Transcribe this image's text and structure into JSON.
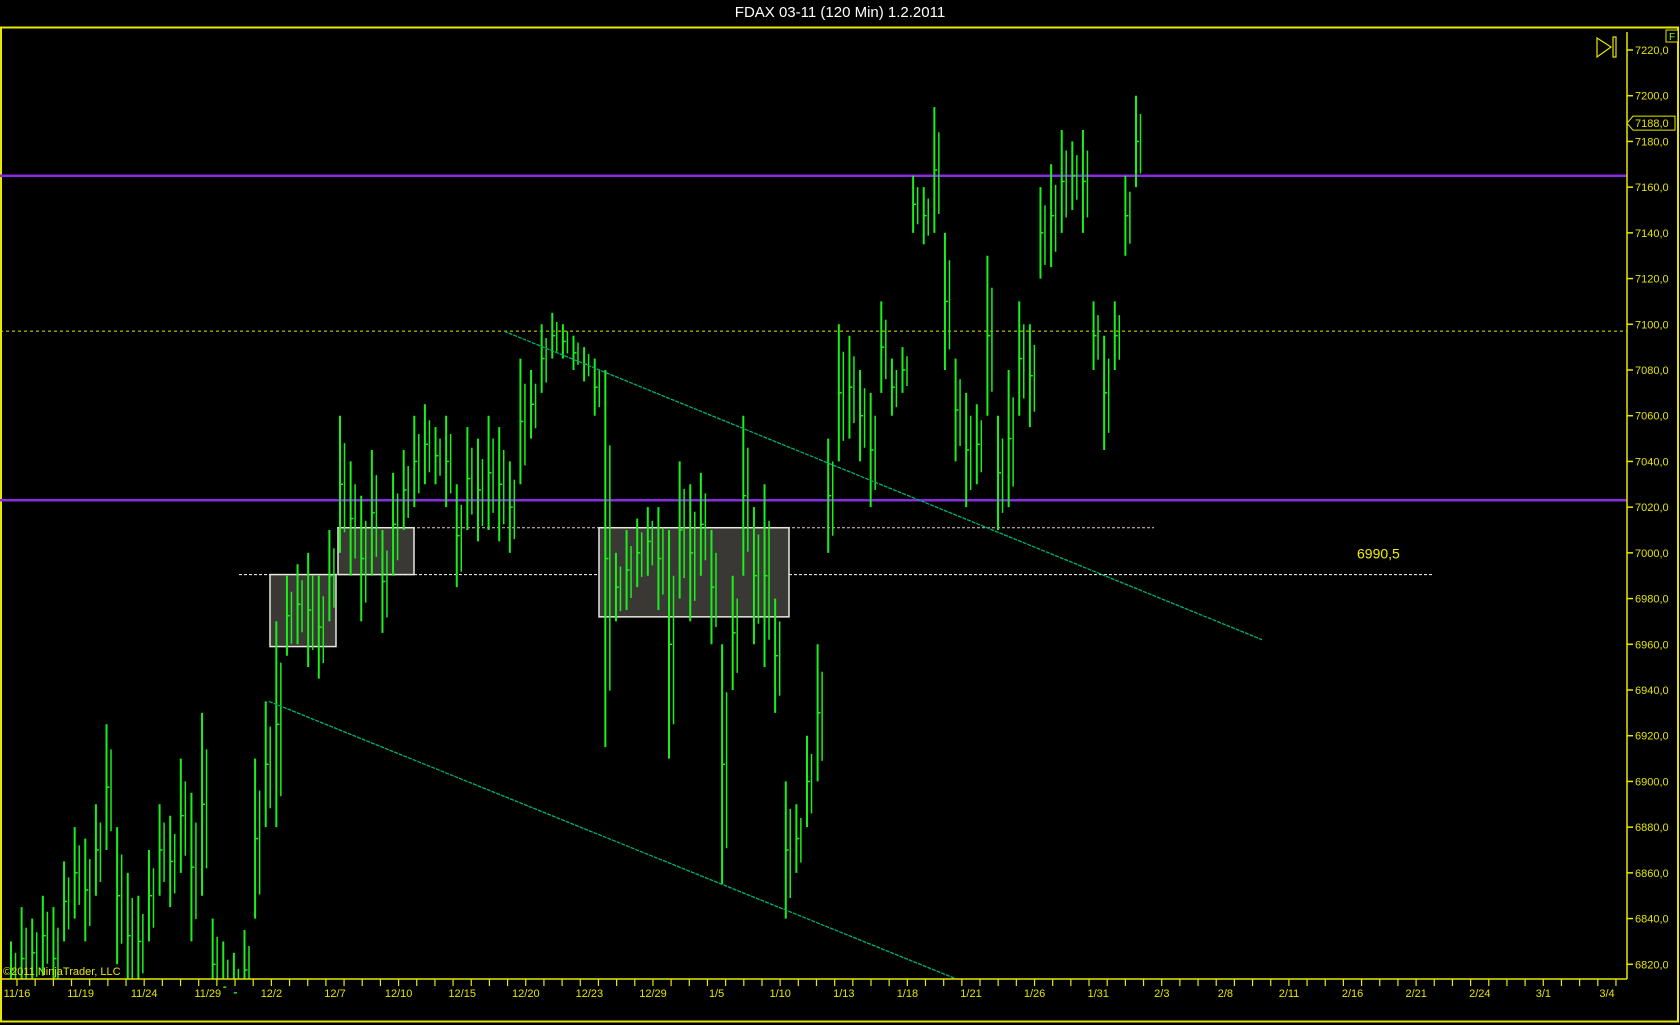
{
  "window": {
    "title": "FDAX 03-11 (120 Min)  1.2.2011"
  },
  "copyright": "©2011 NinjaTrader, LLC",
  "scale_button": "F",
  "colors": {
    "bars": "#19f019",
    "axis": "#e8e800",
    "level": "#8a2be2",
    "trend": "#00b070",
    "box_fill": "#3a3834",
    "box_stroke": "#e8e8e0"
  },
  "chart_data": {
    "type": "bar",
    "title": "FDAX 03-11 (120 Min)  1.2.2011",
    "ylim": [
      6810,
      7228
    ],
    "yticks": [
      "7220,0",
      "7200,0",
      "7180,0",
      "7160,0",
      "7140,0",
      "7120,0",
      "7100,0",
      "7080,0",
      "7060,0",
      "7040,0",
      "7020,0",
      "7000,0",
      "6980,0",
      "6960,0",
      "6940,0",
      "6920,0",
      "6900,0",
      "6880,0",
      "6860,0",
      "6840,0",
      "6820,0"
    ],
    "ytick_values": [
      7220,
      7200,
      7180,
      7160,
      7140,
      7120,
      7100,
      7080,
      7060,
      7040,
      7020,
      7000,
      6980,
      6960,
      6940,
      6920,
      6900,
      6880,
      6860,
      6840,
      6820
    ],
    "xticks": [
      "11/16",
      "11/19",
      "11/24",
      "11/29",
      "12/2",
      "12/7",
      "12/10",
      "12/15",
      "12/20",
      "12/23",
      "12/29",
      "1/5",
      "1/10",
      "1/13",
      "1/18",
      "1/21",
      "1/26",
      "1/31",
      "2/3",
      "2/8",
      "2/11",
      "2/16",
      "2/21",
      "2/24",
      "3/1",
      "3/4"
    ],
    "last_price": {
      "label": "7188,0",
      "value": 7188
    },
    "bars_high_low": [
      [
        6830,
        6805
      ],
      [
        6845,
        6800
      ],
      [
        6840,
        6810
      ],
      [
        6850,
        6815
      ],
      [
        6845,
        6800
      ],
      [
        6865,
        6830
      ],
      [
        6880,
        6840
      ],
      [
        6875,
        6830
      ],
      [
        6890,
        6850
      ],
      [
        6925,
        6870
      ],
      [
        6880,
        6820
      ],
      [
        6860,
        6805
      ],
      [
        6850,
        6810
      ],
      [
        6870,
        6830
      ],
      [
        6890,
        6850
      ],
      [
        6885,
        6845
      ],
      [
        6910,
        6860
      ],
      [
        6895,
        6830
      ],
      [
        6930,
        6850
      ],
      [
        6840,
        6800
      ],
      [
        6830,
        6790
      ],
      [
        6825,
        6790
      ],
      [
        6835,
        6800
      ],
      [
        6910,
        6840
      ],
      [
        6935,
        6880
      ],
      [
        6970,
        6880
      ],
      [
        6990,
        6955
      ],
      [
        6995,
        6960
      ],
      [
        7000,
        6950
      ],
      [
        6990,
        6945
      ],
      [
        7010,
        6970
      ],
      [
        7060,
        7000
      ],
      [
        7040,
        6990
      ],
      [
        7025,
        6970
      ],
      [
        7045,
        6990
      ],
      [
        7010,
        6965
      ],
      [
        7035,
        6990
      ],
      [
        7045,
        7010
      ],
      [
        7060,
        7020
      ],
      [
        7065,
        7030
      ],
      [
        7055,
        7030
      ],
      [
        7060,
        7020
      ],
      [
        7030,
        6985
      ],
      [
        7055,
        7010
      ],
      [
        7050,
        7005
      ],
      [
        7060,
        7010
      ],
      [
        7055,
        7005
      ],
      [
        7040,
        7000
      ],
      [
        7085,
        7030
      ],
      [
        7080,
        7050
      ],
      [
        7100,
        7070
      ],
      [
        7105,
        7085
      ],
      [
        7100,
        7085
      ],
      [
        7095,
        7080
      ],
      [
        7090,
        7075
      ],
      [
        7085,
        7060
      ],
      [
        7080,
        6915
      ],
      [
        7000,
        6970
      ],
      [
        7010,
        6975
      ],
      [
        7015,
        6985
      ],
      [
        7020,
        6990
      ],
      [
        7020,
        6975
      ],
      [
        7010,
        6910
      ],
      [
        7040,
        6980
      ],
      [
        7030,
        6970
      ],
      [
        7035,
        6990
      ],
      [
        7010,
        6960
      ],
      [
        6960,
        6855
      ],
      [
        6990,
        6940
      ],
      [
        7060,
        6990
      ],
      [
        7020,
        6960
      ],
      [
        7030,
        6950
      ],
      [
        6980,
        6930
      ],
      [
        6900,
        6840
      ],
      [
        6890,
        6860
      ],
      [
        6920,
        6880
      ],
      [
        6960,
        6900
      ],
      [
        7050,
        7000
      ],
      [
        7100,
        7040
      ],
      [
        7095,
        7050
      ],
      [
        7080,
        7040
      ],
      [
        7070,
        7020
      ],
      [
        7110,
        7070
      ],
      [
        7085,
        7060
      ],
      [
        7090,
        7070
      ],
      [
        7165,
        7140
      ],
      [
        7160,
        7135
      ],
      [
        7195,
        7140
      ],
      [
        7140,
        7080
      ],
      [
        7085,
        7040
      ],
      [
        7070,
        7020
      ],
      [
        7065,
        7030
      ],
      [
        7130,
        7060
      ],
      [
        7060,
        7010
      ],
      [
        7080,
        7020
      ],
      [
        7110,
        7060
      ],
      [
        7100,
        7055
      ],
      [
        7160,
        7120
      ],
      [
        7170,
        7125
      ],
      [
        7185,
        7140
      ],
      [
        7180,
        7150
      ],
      [
        7185,
        7140
      ],
      [
        7110,
        7080
      ],
      [
        7095,
        7045
      ],
      [
        7110,
        7080
      ],
      [
        7165,
        7130
      ],
      [
        7200,
        7160
      ]
    ],
    "levels": [
      {
        "price": 7165,
        "style": "solid-purple"
      },
      {
        "price": 7023,
        "style": "solid-purple"
      },
      {
        "price": 7097,
        "style": "dotted-yellow"
      },
      {
        "price": 7011,
        "style": "dotted-pink"
      },
      {
        "price": 6990.5,
        "style": "dotted-white"
      }
    ],
    "level_label": "6990,5",
    "boxes": [
      {
        "top": 6990.5,
        "bottom": 6959
      },
      {
        "top": 7011,
        "bottom": 6990.5
      },
      {
        "top": 7011,
        "bottom": 6972
      }
    ],
    "trendlines": [
      {
        "from": 7097,
        "to": 6962
      },
      {
        "from": 6935,
        "to": 6814
      }
    ]
  }
}
